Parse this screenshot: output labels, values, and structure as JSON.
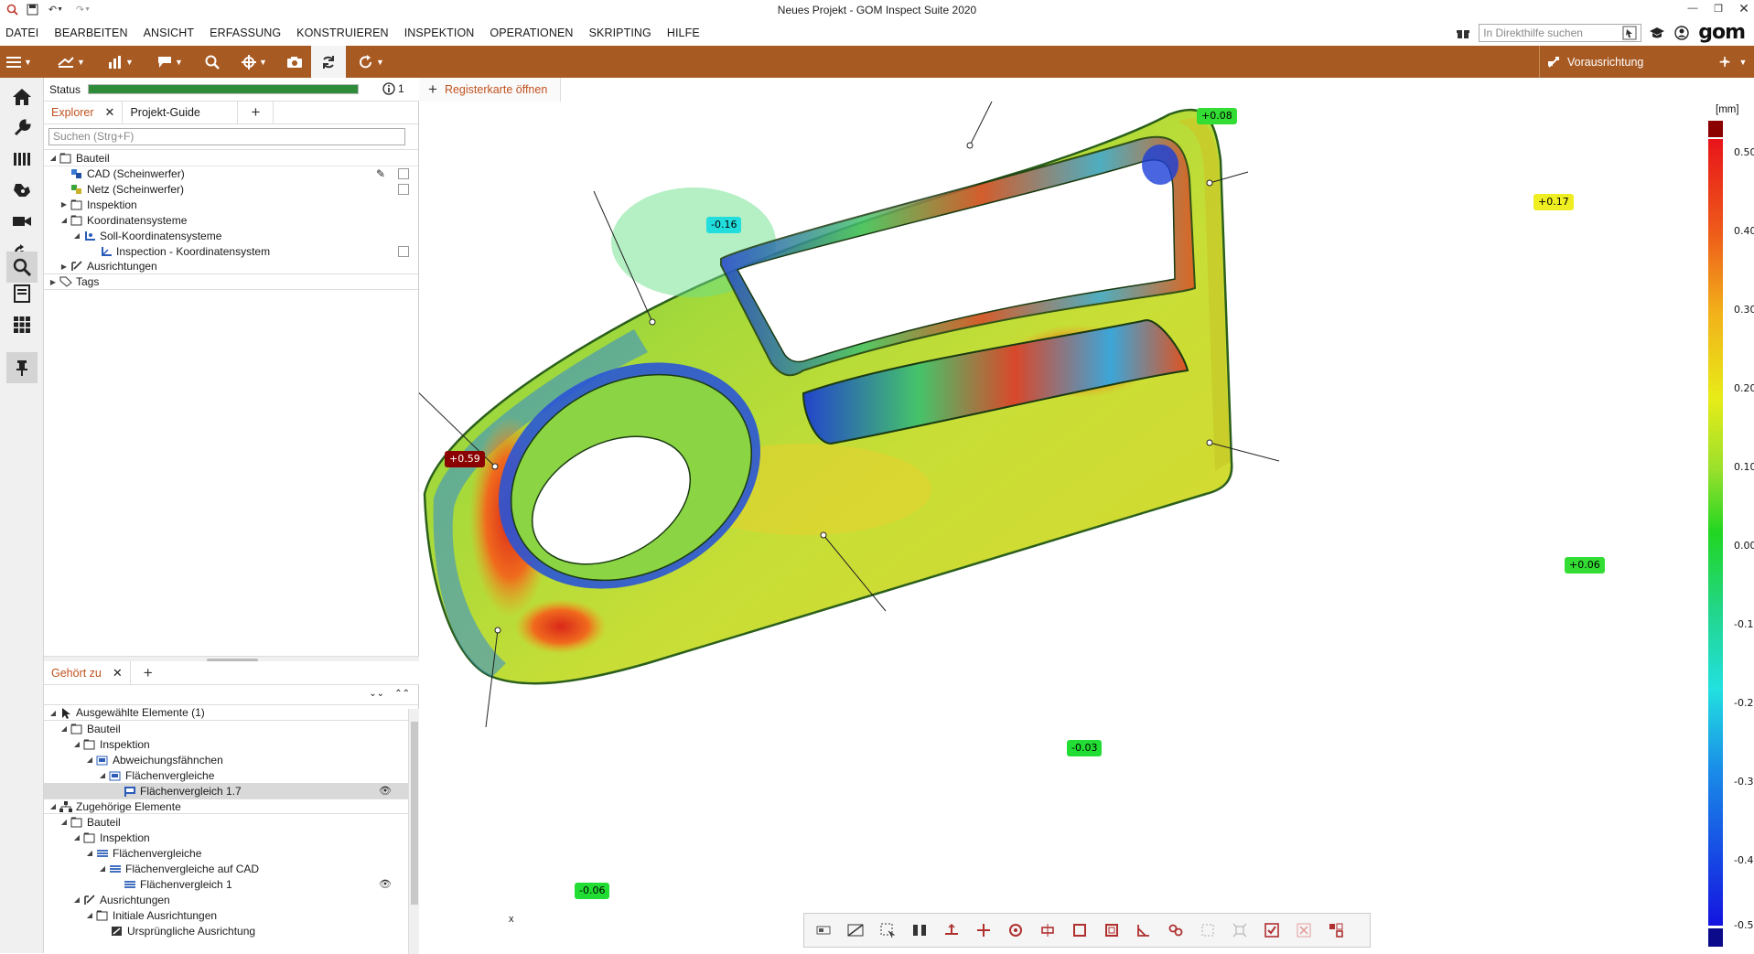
{
  "window": {
    "title": "Neues Projekt - GOM Inspect Suite 2020"
  },
  "menu": [
    "DATEI",
    "BEARBEITEN",
    "ANSICHT",
    "ERFASSUNG",
    "KONSTRUIEREN",
    "INSPEKTION",
    "OPERATIONEN",
    "SKRIPTING",
    "HILFE"
  ],
  "help_search": {
    "placeholder": "In Direkthilfe suchen"
  },
  "brand": "gom",
  "toolbar": {
    "prealignment_label": "Vorausrichtung"
  },
  "status": {
    "label": "Status",
    "progress": 1.0,
    "info_count": "1"
  },
  "explorer": {
    "tabs": [
      "Explorer",
      "Projekt-Guide"
    ],
    "search_placeholder": "Suchen (Strg+F)",
    "tree": [
      {
        "label": "Bauteil"
      },
      {
        "label": "CAD (Scheinwerfer)"
      },
      {
        "label": "Netz (Scheinwerfer)"
      },
      {
        "label": "Inspektion"
      },
      {
        "label": "Koordinatensysteme"
      },
      {
        "label": "Soll-Koordinatensysteme"
      },
      {
        "label": "Inspection - Koordinatensystem"
      },
      {
        "label": "Ausrichtungen"
      },
      {
        "label": "Tags"
      }
    ]
  },
  "belongs": {
    "tab": "Gehört zu",
    "tree": [
      {
        "label": "Ausgewählte Elemente (1)"
      },
      {
        "label": "Bauteil"
      },
      {
        "label": "Inspektion"
      },
      {
        "label": "Abweichungsfähnchen"
      },
      {
        "label": "Flächenvergleiche"
      },
      {
        "label": "Flächenvergleich 1.7"
      },
      {
        "label": "Zugehörige Elemente"
      },
      {
        "label": "Bauteil"
      },
      {
        "label": "Inspektion"
      },
      {
        "label": "Flächenvergleiche"
      },
      {
        "label": "Flächenvergleiche auf CAD"
      },
      {
        "label": "Flächenvergleich 1"
      },
      {
        "label": "Ausrichtungen"
      },
      {
        "label": "Initiale Ausrichtungen"
      },
      {
        "label": "Ursprüngliche Ausrichtung"
      }
    ]
  },
  "view": {
    "open_tab_label": "Registerkarte öffnen"
  },
  "deviation_flags": [
    {
      "label": "+0.08",
      "color": "#33dd33"
    },
    {
      "label": "+0.17",
      "color": "#eeee22"
    },
    {
      "label": "-0.16",
      "color": "#22dddd"
    },
    {
      "label": "+0.59",
      "color": "#8b0000"
    },
    {
      "label": "+0.06",
      "color": "#33dd33"
    },
    {
      "label": "-0.03",
      "color": "#22dd33"
    },
    {
      "label": "-0.06",
      "color": "#22dd33"
    }
  ],
  "legend": {
    "unit": "[mm]",
    "ticks": [
      "0.50",
      "0.40",
      "0.30",
      "0.20",
      "0.10",
      "0.00",
      "-0.10",
      "-0.20",
      "-0.30",
      "-0.40",
      "-0.50"
    ],
    "over_color": "#8b0000",
    "under_color": "#0a0a8a"
  },
  "axes": {
    "x_label": "x"
  }
}
